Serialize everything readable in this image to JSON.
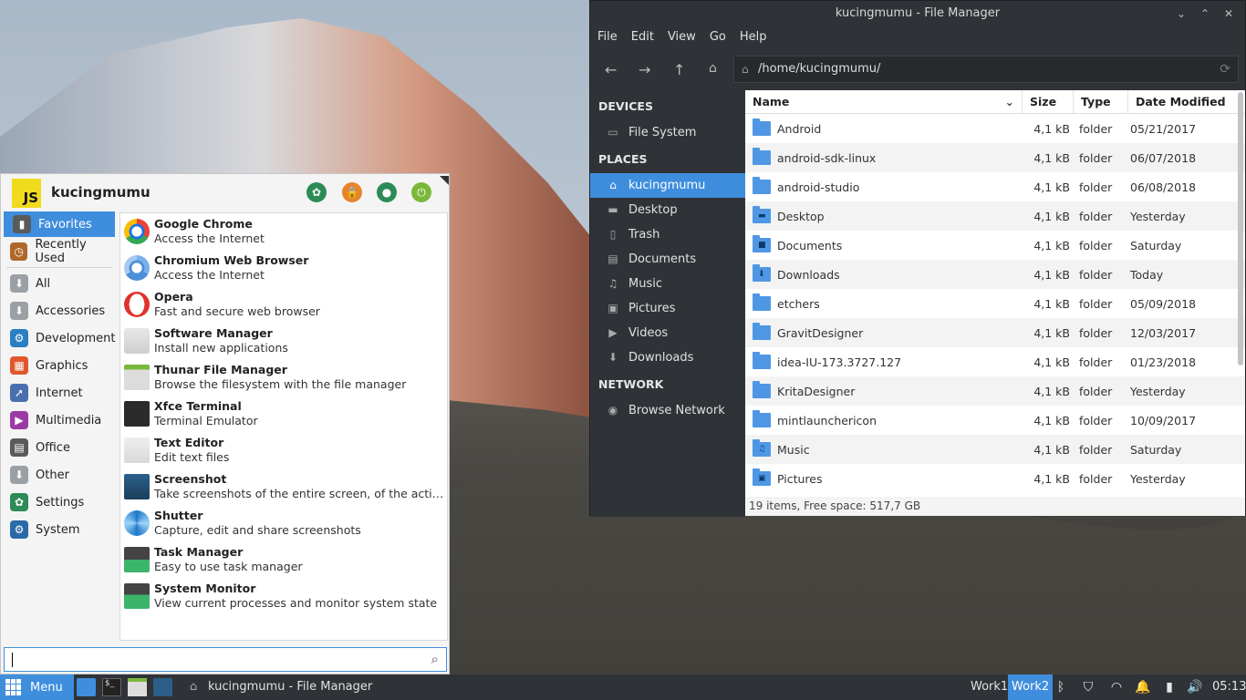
{
  "desktop": {},
  "menu": {
    "avatar_text": "JS",
    "username": "kucingmumu",
    "categories": [
      {
        "label": "Favorites",
        "icon": "bookmark-icon",
        "color": "#5a5a5a"
      },
      {
        "label": "Recently Used",
        "icon": "clock-icon",
        "color": "#b0672a"
      },
      {
        "label": "All",
        "icon": "package-icon",
        "color": "#9aa0a6"
      },
      {
        "label": "Accessories",
        "icon": "accessories-icon",
        "color": "#9aa0a6"
      },
      {
        "label": "Development",
        "icon": "development-icon",
        "color": "#2a7fc2"
      },
      {
        "label": "Graphics",
        "icon": "graphics-icon",
        "color": "#e0572d"
      },
      {
        "label": "Internet",
        "icon": "internet-icon",
        "color": "#4a6fae"
      },
      {
        "label": "Multimedia",
        "icon": "multimedia-icon",
        "color": "#9b3aa4"
      },
      {
        "label": "Office",
        "icon": "office-icon",
        "color": "#5a5a5a"
      },
      {
        "label": "Other",
        "icon": "other-icon",
        "color": "#9aa0a6"
      },
      {
        "label": "Settings",
        "icon": "settings-icon",
        "color": "#2e8b57"
      },
      {
        "label": "System",
        "icon": "system-icon",
        "color": "#2a6aa8"
      }
    ],
    "apps": [
      {
        "name": "Google Chrome",
        "desc": "Access the Internet"
      },
      {
        "name": "Chromium Web Browser",
        "desc": "Access the Internet"
      },
      {
        "name": "Opera",
        "desc": "Fast and secure web browser"
      },
      {
        "name": "Software Manager",
        "desc": "Install new applications"
      },
      {
        "name": "Thunar File Manager",
        "desc": "Browse the filesystem with the file manager"
      },
      {
        "name": "Xfce Terminal",
        "desc": "Terminal Emulator"
      },
      {
        "name": "Text Editor",
        "desc": "Edit text files"
      },
      {
        "name": "Screenshot",
        "desc": "Take screenshots of the entire screen, of the active win..."
      },
      {
        "name": "Shutter",
        "desc": "Capture, edit and share screenshots"
      },
      {
        "name": "Task Manager",
        "desc": "Easy to use task manager"
      },
      {
        "name": "System Monitor",
        "desc": "View current processes and monitor system state"
      }
    ],
    "search_value": ""
  },
  "filemanager": {
    "title": "kucingmumu - File Manager",
    "menubar": [
      "File",
      "Edit",
      "View",
      "Go",
      "Help"
    ],
    "path": "/home/kucingmumu/",
    "sidebar": {
      "devices_heading": "DEVICES",
      "devices": [
        "File System"
      ],
      "places_heading": "PLACES",
      "places": [
        "kucingmumu",
        "Desktop",
        "Trash",
        "Documents",
        "Music",
        "Pictures",
        "Videos",
        "Downloads"
      ],
      "network_heading": "NETWORK",
      "network": [
        "Browse Network"
      ]
    },
    "columns": [
      "Name",
      "Size",
      "Type",
      "Date Modified"
    ],
    "rows": [
      {
        "name": "Android",
        "size": "4,1 kB",
        "type": "folder",
        "date": "05/21/2017",
        "glyph": ""
      },
      {
        "name": "android-sdk-linux",
        "size": "4,1 kB",
        "type": "folder",
        "date": "06/07/2018",
        "glyph": ""
      },
      {
        "name": "android-studio",
        "size": "4,1 kB",
        "type": "folder",
        "date": "06/08/2018",
        "glyph": ""
      },
      {
        "name": "Desktop",
        "size": "4,1 kB",
        "type": "folder",
        "date": "Yesterday",
        "glyph": "▬"
      },
      {
        "name": "Documents",
        "size": "4,1 kB",
        "type": "folder",
        "date": "Saturday",
        "glyph": "■"
      },
      {
        "name": "Downloads",
        "size": "4,1 kB",
        "type": "folder",
        "date": "Today",
        "glyph": "⬇"
      },
      {
        "name": "etchers",
        "size": "4,1 kB",
        "type": "folder",
        "date": "05/09/2018",
        "glyph": ""
      },
      {
        "name": "GravitDesigner",
        "size": "4,1 kB",
        "type": "folder",
        "date": "12/03/2017",
        "glyph": ""
      },
      {
        "name": "idea-IU-173.3727.127",
        "size": "4,1 kB",
        "type": "folder",
        "date": "01/23/2018",
        "glyph": ""
      },
      {
        "name": "KritaDesigner",
        "size": "4,1 kB",
        "type": "folder",
        "date": "Yesterday",
        "glyph": ""
      },
      {
        "name": "mintlaunchericon",
        "size": "4,1 kB",
        "type": "folder",
        "date": "10/09/2017",
        "glyph": ""
      },
      {
        "name": "Music",
        "size": "4,1 kB",
        "type": "folder",
        "date": "Saturday",
        "glyph": "♫"
      },
      {
        "name": "Pictures",
        "size": "4,1 kB",
        "type": "folder",
        "date": "Yesterday",
        "glyph": "▣"
      }
    ],
    "status": "19 items, Free space: 517,7 GB"
  },
  "panel": {
    "menu_label": "Menu",
    "task_label": "kucingmumu - File Manager",
    "workspaces": [
      "Work1",
      "Work2"
    ],
    "clock": "05:13"
  }
}
